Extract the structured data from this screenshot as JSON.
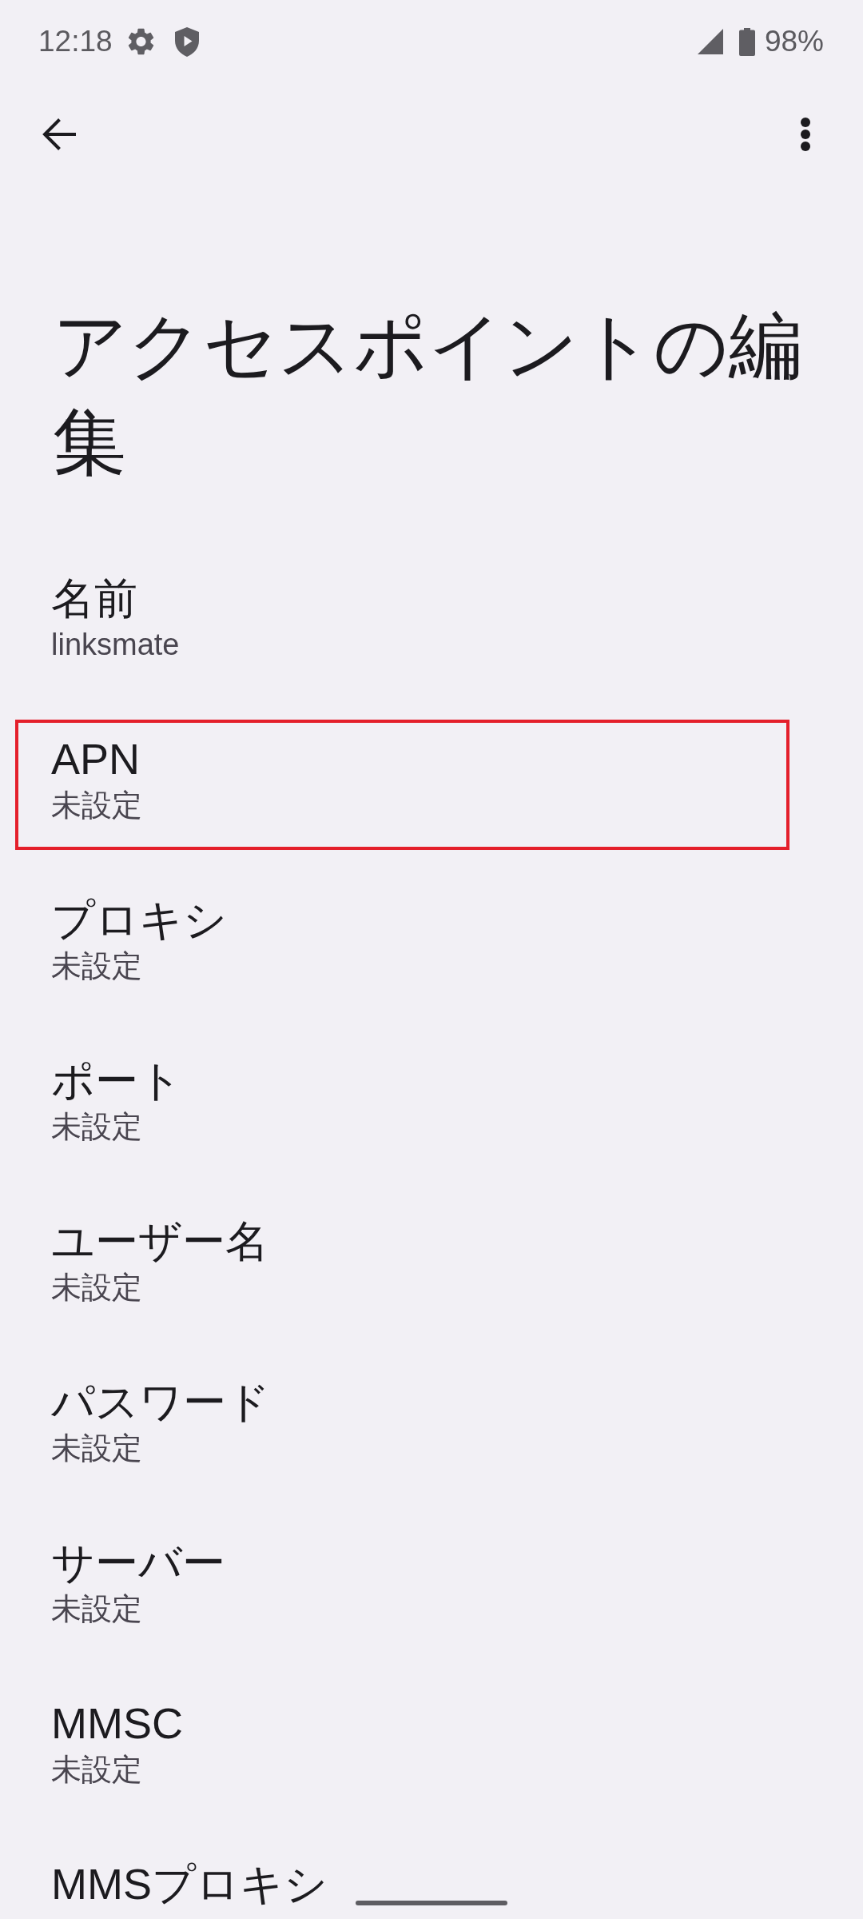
{
  "status_bar": {
    "time": "12:18",
    "battery": "98%"
  },
  "title": "アクセスポイントの編集",
  "items": [
    {
      "label": "名前",
      "value": "linksmate",
      "highlighted": false
    },
    {
      "label": "APN",
      "value": "未設定",
      "highlighted": true
    },
    {
      "label": "プロキシ",
      "value": "未設定",
      "highlighted": false
    },
    {
      "label": "ポート",
      "value": "未設定",
      "highlighted": false
    },
    {
      "label": "ユーザー名",
      "value": "未設定",
      "highlighted": false
    },
    {
      "label": "パスワード",
      "value": "未設定",
      "highlighted": false
    },
    {
      "label": "サーバー",
      "value": "未設定",
      "highlighted": false
    },
    {
      "label": "MMSC",
      "value": "未設定",
      "highlighted": false
    },
    {
      "label": "MMSプロキシ",
      "highlighted": false
    }
  ]
}
